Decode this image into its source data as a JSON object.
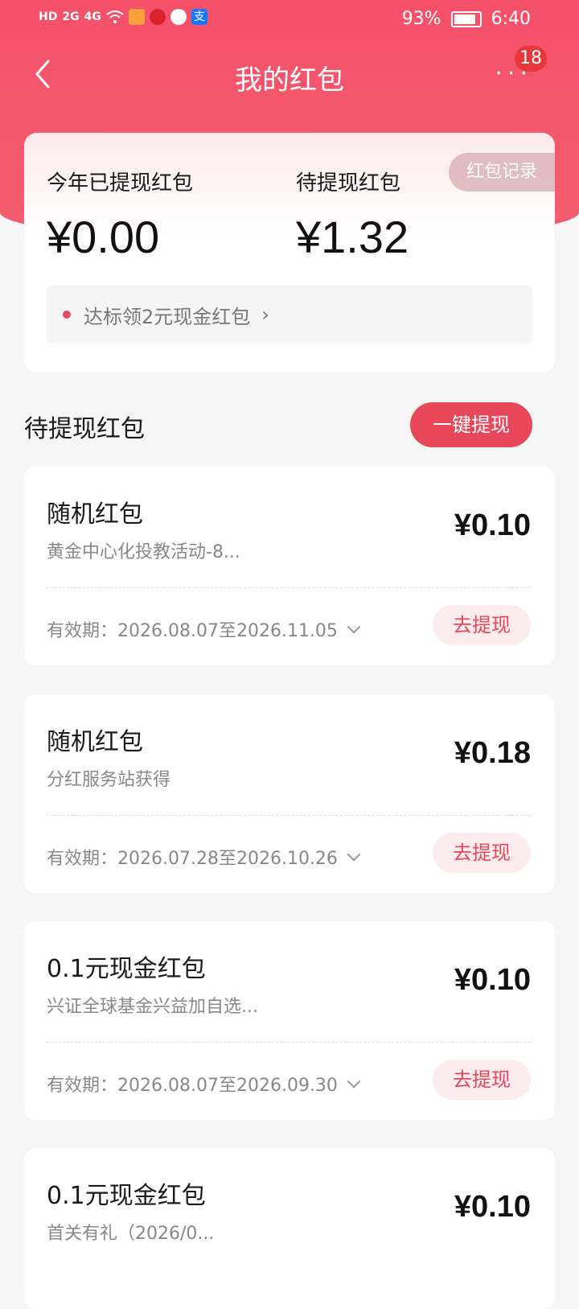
{
  "status": {
    "time": "6:40",
    "battery": "93%",
    "left_icons": [
      "HD",
      "2G",
      "4G",
      "wifi",
      "app",
      "app",
      "chat",
      "支"
    ]
  },
  "nav": {
    "title": "我的红包",
    "more_label": "···",
    "badge": "18"
  },
  "summary": {
    "withdrawn_label": "今年已提现红包",
    "withdrawn_value": "¥0.00",
    "pending_label": "待提现红包",
    "pending_value": "¥1.32",
    "record_button": "红包记录",
    "promo_text": "达标领2元现金红包",
    "promo_arrow": "›"
  },
  "section": {
    "title": "待提现红包",
    "withdraw_all": "一键提现"
  },
  "packets": [
    {
      "name": "随机红包",
      "desc": "黄金中心化投教活动-8...",
      "amount": "¥0.10",
      "validity": "有效期：2026.08.07至2026.11.05",
      "button": "去提现"
    },
    {
      "name": "随机红包",
      "desc": "分红服务站获得",
      "amount": "¥0.18",
      "validity": "有效期：2026.07.28至2026.10.26",
      "button": "去提现"
    },
    {
      "name": "0.1元现金红包",
      "desc": "兴证全球基金兴益加自选...",
      "amount": "¥0.10",
      "validity": "有效期：2026.08.07至2026.09.30",
      "button": "去提现"
    },
    {
      "name": "0.1元现金红包",
      "desc": "首关有礼（2026/0...",
      "amount": "¥0.10",
      "validity": "",
      "button": ""
    }
  ],
  "colors": {
    "header": "#f4506a",
    "accent": "#e8475a",
    "button_bg_light": "#fcecee"
  }
}
